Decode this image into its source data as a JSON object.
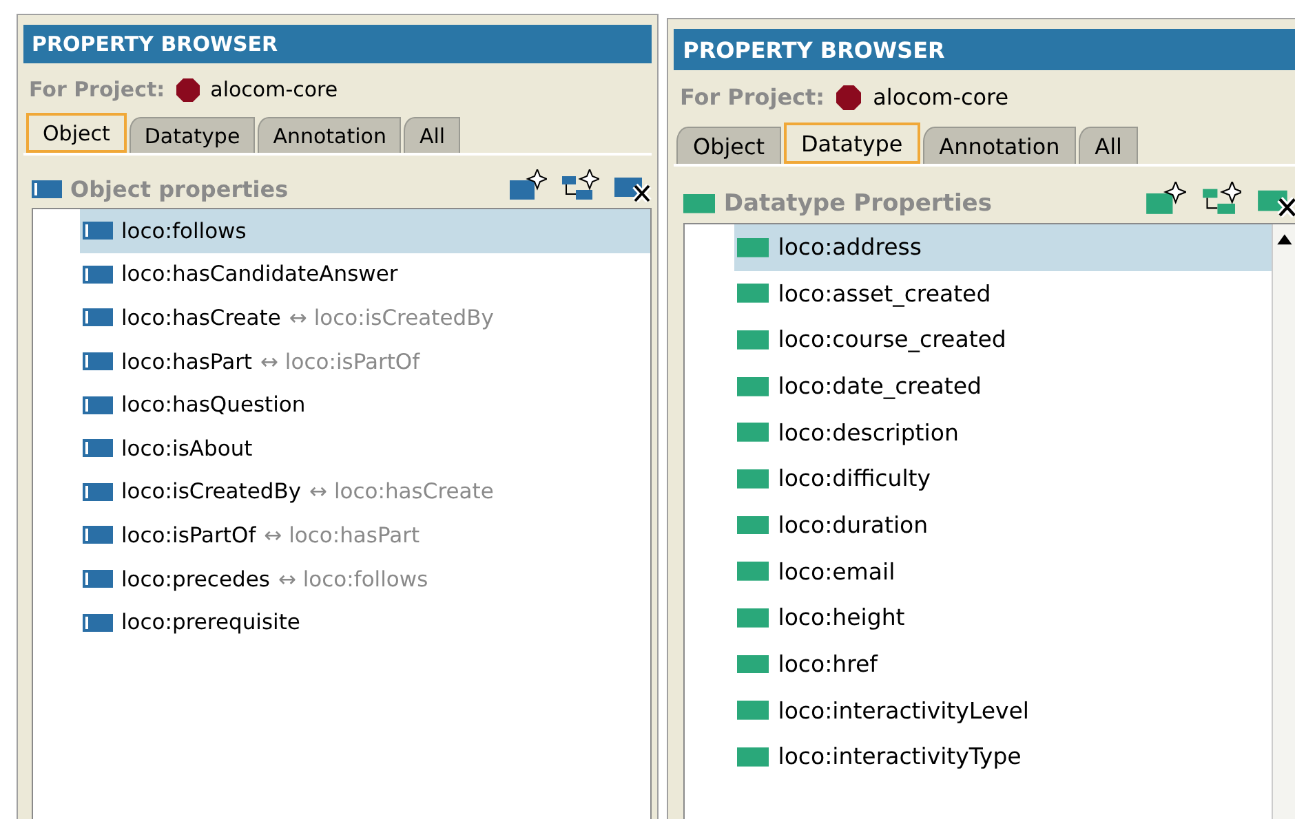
{
  "panels": [
    {
      "title": "PROPERTY BROWSER",
      "project_label": "For Project:",
      "project": "alocom-core",
      "kind": "object",
      "tabs": [
        {
          "label": "Object",
          "selected": true
        },
        {
          "label": "Datatype",
          "selected": false
        },
        {
          "label": "Annotation",
          "selected": false
        },
        {
          "label": "All",
          "selected": false
        }
      ],
      "section": "Object properties",
      "scrollbar": false,
      "items": [
        {
          "name": "loco:follows",
          "selected": true
        },
        {
          "name": "loco:hasCandidateAnswer",
          "selected": false
        },
        {
          "name": "loco:hasCreate",
          "inverse": "↔ loco:isCreatedBy",
          "selected": false
        },
        {
          "name": "loco:hasPart",
          "inverse": "↔ loco:isPartOf",
          "selected": false
        },
        {
          "name": "loco:hasQuestion",
          "selected": false
        },
        {
          "name": "loco:isAbout",
          "selected": false
        },
        {
          "name": "loco:isCreatedBy",
          "inverse": "↔ loco:hasCreate",
          "selected": false
        },
        {
          "name": "loco:isPartOf",
          "inverse": "↔ loco:hasPart",
          "selected": false
        },
        {
          "name": "loco:precedes",
          "inverse": "↔ loco:follows",
          "selected": false
        },
        {
          "name": "loco:prerequisite",
          "selected": false
        }
      ]
    },
    {
      "title": "PROPERTY BROWSER",
      "project_label": "For Project:",
      "project": "alocom-core",
      "kind": "datatype",
      "tabs": [
        {
          "label": "Object",
          "selected": false
        },
        {
          "label": "Datatype",
          "selected": true
        },
        {
          "label": "Annotation",
          "selected": false
        },
        {
          "label": "All",
          "selected": false
        }
      ],
      "section": "Datatype Properties",
      "scrollbar": true,
      "items": [
        {
          "name": "loco:address",
          "selected": true
        },
        {
          "name": "loco:asset_created",
          "selected": false
        },
        {
          "name": "loco:course_created",
          "selected": false
        },
        {
          "name": "loco:date_created",
          "selected": false
        },
        {
          "name": "loco:description",
          "selected": false
        },
        {
          "name": "loco:difficulty",
          "selected": false
        },
        {
          "name": "loco:duration",
          "selected": false
        },
        {
          "name": "loco:email",
          "selected": false
        },
        {
          "name": "loco:height",
          "selected": false
        },
        {
          "name": "loco:href",
          "selected": false
        },
        {
          "name": "loco:interactivityLevel",
          "selected": false
        },
        {
          "name": "loco:interactivityType",
          "selected": false
        }
      ]
    }
  ]
}
